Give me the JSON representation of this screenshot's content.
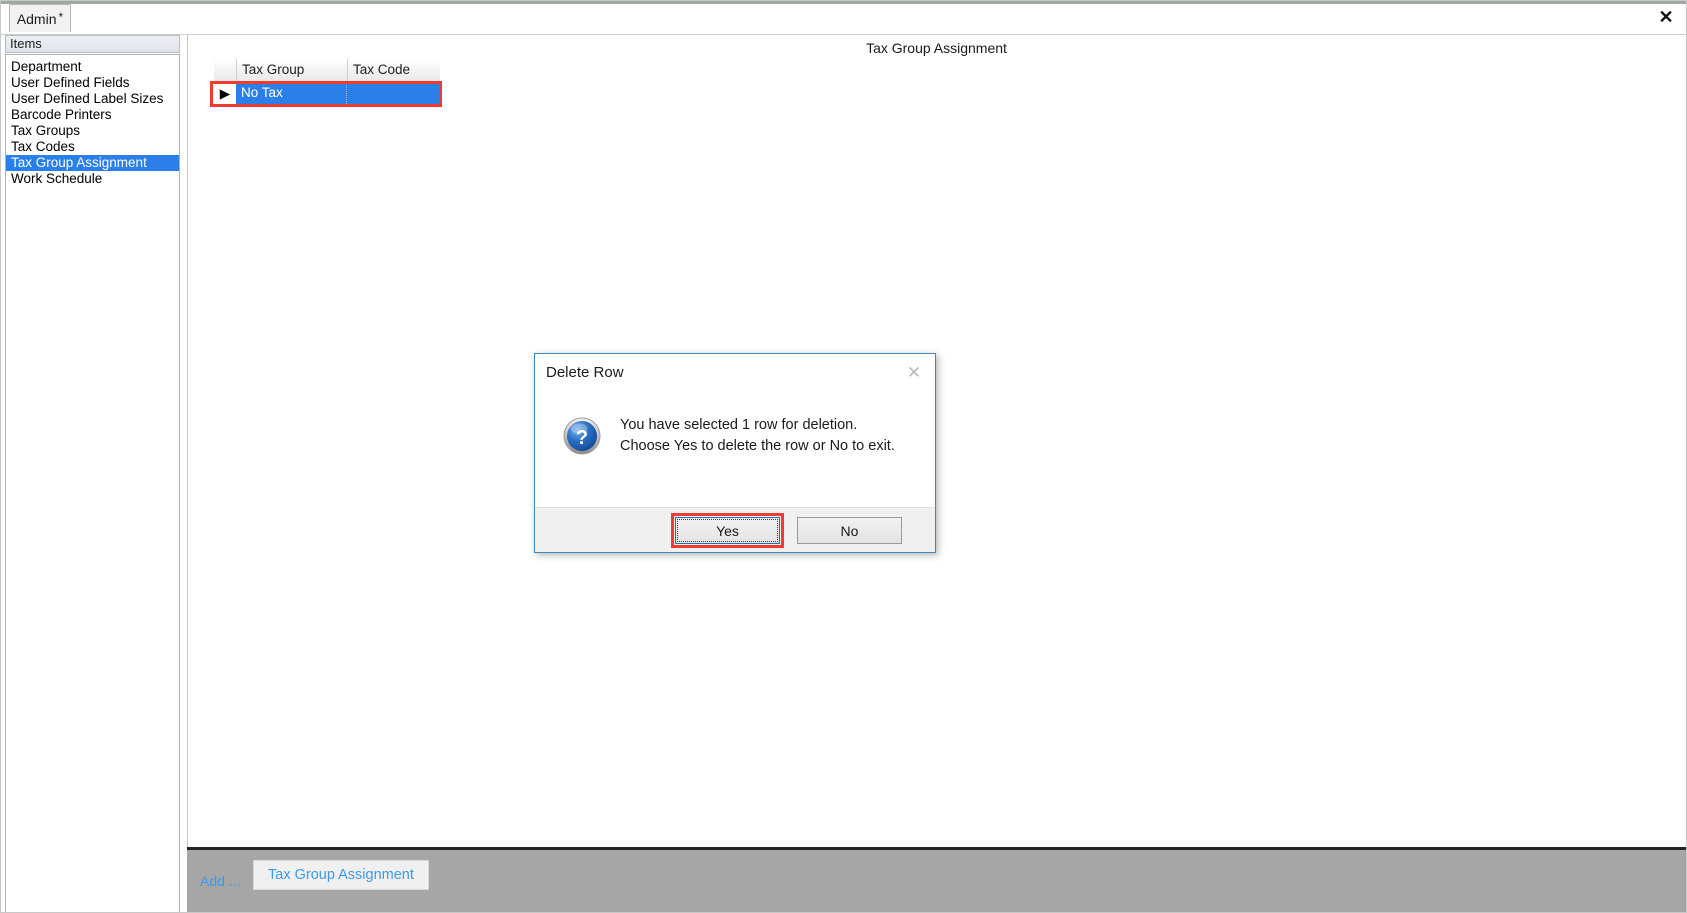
{
  "window": {
    "close_label": "✕"
  },
  "tabs": {
    "admin_label": "Admin",
    "admin_modified_marker": "*"
  },
  "sidebar": {
    "header": "Items",
    "items": [
      {
        "label": "Department",
        "selected": false
      },
      {
        "label": "User Defined Fields",
        "selected": false
      },
      {
        "label": "User Defined Label Sizes",
        "selected": false
      },
      {
        "label": "Barcode Printers",
        "selected": false
      },
      {
        "label": "Tax Groups",
        "selected": false
      },
      {
        "label": "Tax Codes",
        "selected": false
      },
      {
        "label": "Tax Group Assignment",
        "selected": true
      },
      {
        "label": "Work Schedule",
        "selected": false
      }
    ]
  },
  "content": {
    "title": "Tax Group Assignment",
    "grid": {
      "columns": [
        "Tax Group",
        "Tax Code"
      ],
      "row_indicator": "▶",
      "rows": [
        {
          "tax_group": "No Tax",
          "tax_code": "",
          "selected": true
        }
      ]
    }
  },
  "bottom_bar": {
    "add_label": "Add ...",
    "active_tab_label": "Tax Group Assignment"
  },
  "dialog": {
    "title": "Delete Row",
    "close_label": "✕",
    "icon": "question-icon",
    "icon_glyph": "?",
    "message_line1": "You have selected 1 row for deletion.",
    "message_line2": "Choose Yes to delete the row or No to exit.",
    "yes_label": "Yes",
    "no_label": "No"
  },
  "colors": {
    "selection_blue": "#2a7fe8",
    "annotation_red": "#f03c2e",
    "dialog_border_blue": "#3b8ac4",
    "link_blue": "#3c9ae8",
    "bottom_bar_gray": "#a6a6a6"
  }
}
